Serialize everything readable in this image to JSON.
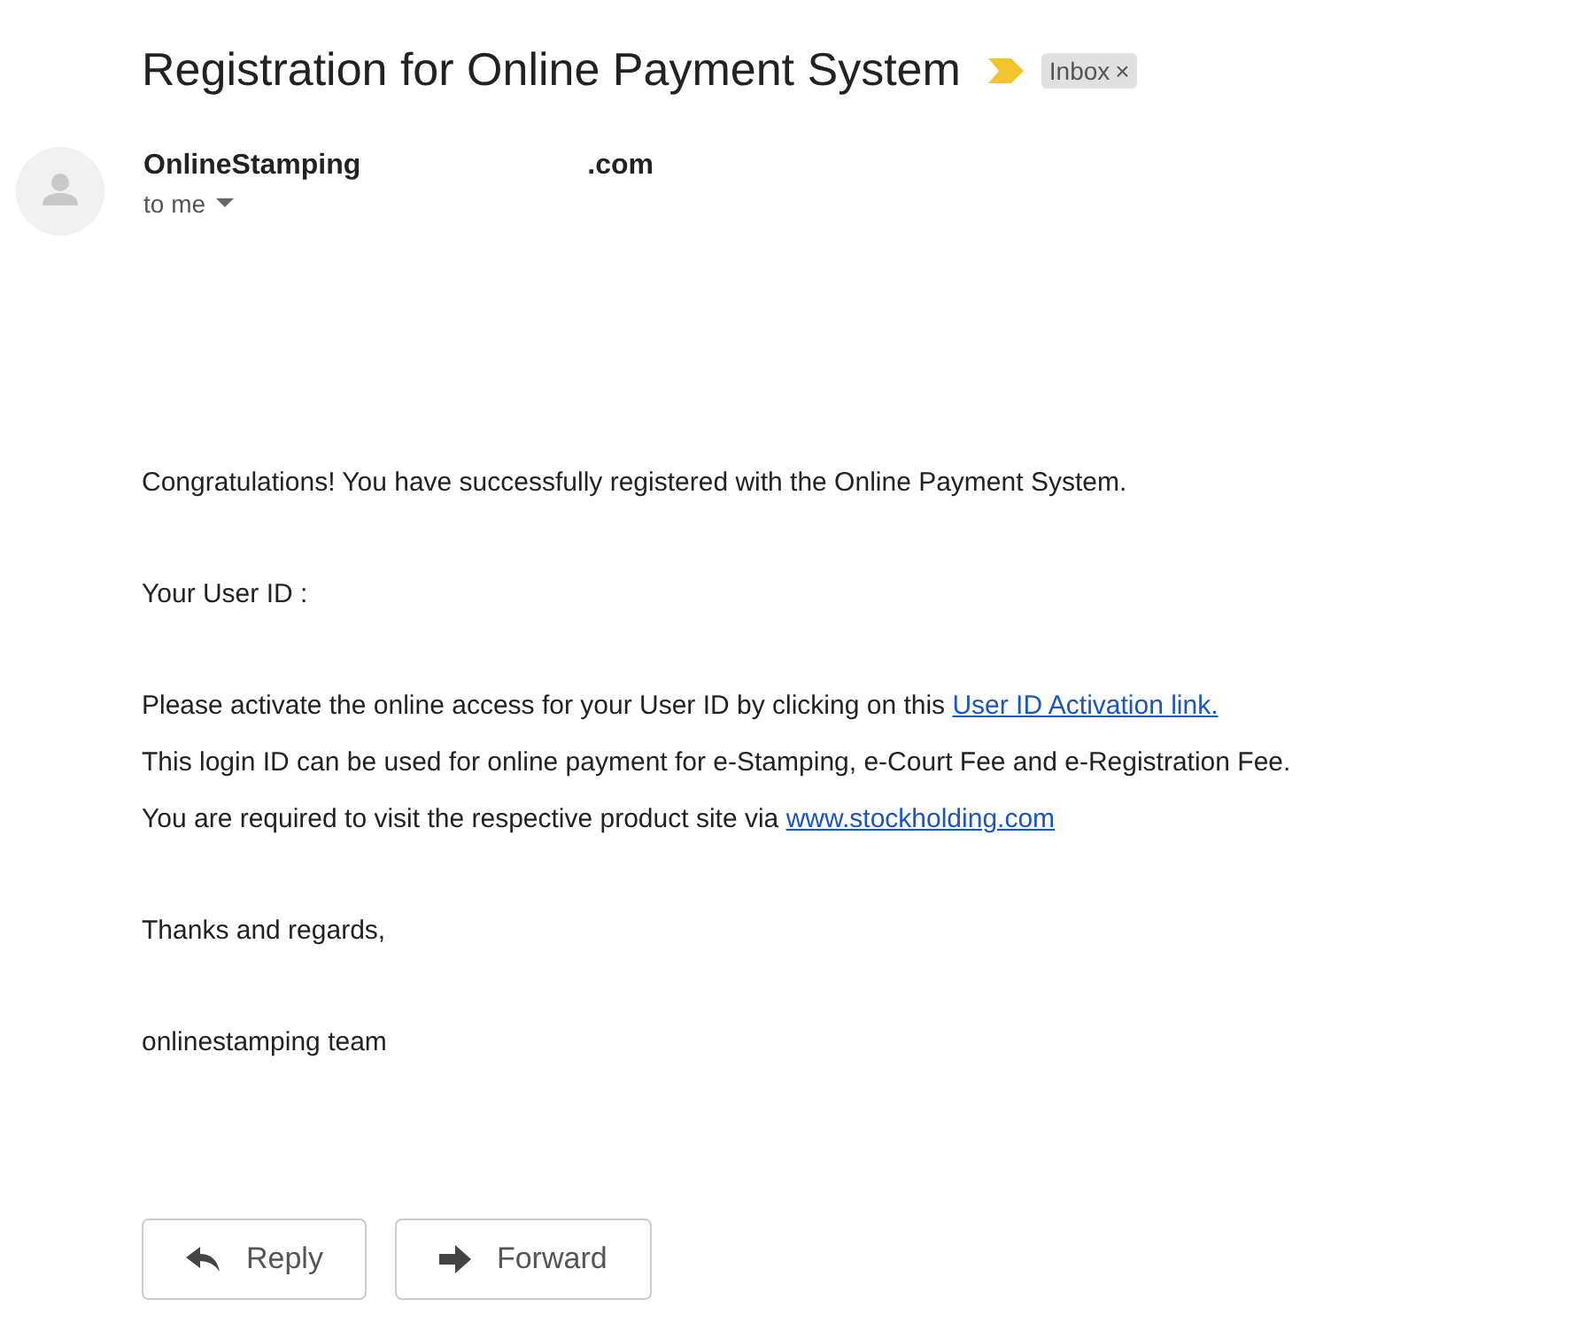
{
  "subject": "Registration for Online Payment System",
  "label": {
    "text": "Inbox",
    "close": "×"
  },
  "sender": {
    "name": "OnlineStamping",
    "domain": ".com",
    "recipient": "to me"
  },
  "body": [
    [
      {
        "text": "Congratulations! You have successfully registered with the Online Payment System."
      }
    ],
    [
      {
        "text": "Your User ID :"
      }
    ],
    [
      {
        "text": "Please activate the online access for your User ID by clicking on this ",
        "link": "User ID Activation link."
      },
      {
        "text": "This login ID can be used for online payment for e-Stamping, e-Court Fee and e-Registration Fee."
      },
      {
        "text": "You are required to visit the respective product site via ",
        "link": "www.stockholding.com"
      }
    ],
    [
      {
        "text": "Thanks and regards,"
      }
    ],
    [
      {
        "text": "onlinestamping team"
      }
    ]
  ],
  "actions": [
    {
      "kind": "reply",
      "label": "Reply"
    },
    {
      "kind": "forward",
      "label": "Forward"
    }
  ]
}
